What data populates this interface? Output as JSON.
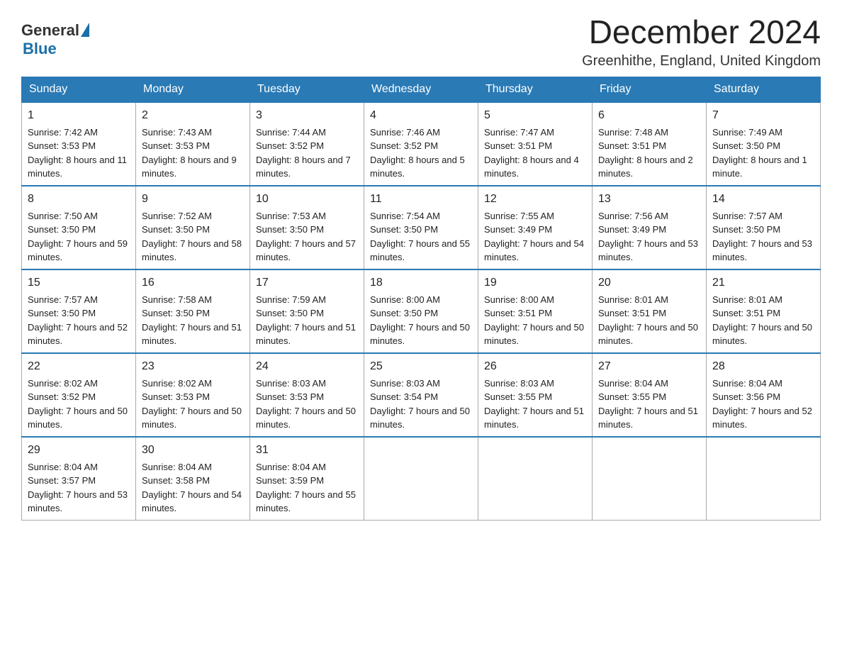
{
  "header": {
    "logo_general": "General",
    "logo_blue": "Blue",
    "title": "December 2024",
    "subtitle": "Greenhithe, England, United Kingdom"
  },
  "days_of_week": [
    "Sunday",
    "Monday",
    "Tuesday",
    "Wednesday",
    "Thursday",
    "Friday",
    "Saturday"
  ],
  "weeks": [
    [
      {
        "day": "1",
        "sunrise": "Sunrise: 7:42 AM",
        "sunset": "Sunset: 3:53 PM",
        "daylight": "Daylight: 8 hours and 11 minutes."
      },
      {
        "day": "2",
        "sunrise": "Sunrise: 7:43 AM",
        "sunset": "Sunset: 3:53 PM",
        "daylight": "Daylight: 8 hours and 9 minutes."
      },
      {
        "day": "3",
        "sunrise": "Sunrise: 7:44 AM",
        "sunset": "Sunset: 3:52 PM",
        "daylight": "Daylight: 8 hours and 7 minutes."
      },
      {
        "day": "4",
        "sunrise": "Sunrise: 7:46 AM",
        "sunset": "Sunset: 3:52 PM",
        "daylight": "Daylight: 8 hours and 5 minutes."
      },
      {
        "day": "5",
        "sunrise": "Sunrise: 7:47 AM",
        "sunset": "Sunset: 3:51 PM",
        "daylight": "Daylight: 8 hours and 4 minutes."
      },
      {
        "day": "6",
        "sunrise": "Sunrise: 7:48 AM",
        "sunset": "Sunset: 3:51 PM",
        "daylight": "Daylight: 8 hours and 2 minutes."
      },
      {
        "day": "7",
        "sunrise": "Sunrise: 7:49 AM",
        "sunset": "Sunset: 3:50 PM",
        "daylight": "Daylight: 8 hours and 1 minute."
      }
    ],
    [
      {
        "day": "8",
        "sunrise": "Sunrise: 7:50 AM",
        "sunset": "Sunset: 3:50 PM",
        "daylight": "Daylight: 7 hours and 59 minutes."
      },
      {
        "day": "9",
        "sunrise": "Sunrise: 7:52 AM",
        "sunset": "Sunset: 3:50 PM",
        "daylight": "Daylight: 7 hours and 58 minutes."
      },
      {
        "day": "10",
        "sunrise": "Sunrise: 7:53 AM",
        "sunset": "Sunset: 3:50 PM",
        "daylight": "Daylight: 7 hours and 57 minutes."
      },
      {
        "day": "11",
        "sunrise": "Sunrise: 7:54 AM",
        "sunset": "Sunset: 3:50 PM",
        "daylight": "Daylight: 7 hours and 55 minutes."
      },
      {
        "day": "12",
        "sunrise": "Sunrise: 7:55 AM",
        "sunset": "Sunset: 3:49 PM",
        "daylight": "Daylight: 7 hours and 54 minutes."
      },
      {
        "day": "13",
        "sunrise": "Sunrise: 7:56 AM",
        "sunset": "Sunset: 3:49 PM",
        "daylight": "Daylight: 7 hours and 53 minutes."
      },
      {
        "day": "14",
        "sunrise": "Sunrise: 7:57 AM",
        "sunset": "Sunset: 3:50 PM",
        "daylight": "Daylight: 7 hours and 53 minutes."
      }
    ],
    [
      {
        "day": "15",
        "sunrise": "Sunrise: 7:57 AM",
        "sunset": "Sunset: 3:50 PM",
        "daylight": "Daylight: 7 hours and 52 minutes."
      },
      {
        "day": "16",
        "sunrise": "Sunrise: 7:58 AM",
        "sunset": "Sunset: 3:50 PM",
        "daylight": "Daylight: 7 hours and 51 minutes."
      },
      {
        "day": "17",
        "sunrise": "Sunrise: 7:59 AM",
        "sunset": "Sunset: 3:50 PM",
        "daylight": "Daylight: 7 hours and 51 minutes."
      },
      {
        "day": "18",
        "sunrise": "Sunrise: 8:00 AM",
        "sunset": "Sunset: 3:50 PM",
        "daylight": "Daylight: 7 hours and 50 minutes."
      },
      {
        "day": "19",
        "sunrise": "Sunrise: 8:00 AM",
        "sunset": "Sunset: 3:51 PM",
        "daylight": "Daylight: 7 hours and 50 minutes."
      },
      {
        "day": "20",
        "sunrise": "Sunrise: 8:01 AM",
        "sunset": "Sunset: 3:51 PM",
        "daylight": "Daylight: 7 hours and 50 minutes."
      },
      {
        "day": "21",
        "sunrise": "Sunrise: 8:01 AM",
        "sunset": "Sunset: 3:51 PM",
        "daylight": "Daylight: 7 hours and 50 minutes."
      }
    ],
    [
      {
        "day": "22",
        "sunrise": "Sunrise: 8:02 AM",
        "sunset": "Sunset: 3:52 PM",
        "daylight": "Daylight: 7 hours and 50 minutes."
      },
      {
        "day": "23",
        "sunrise": "Sunrise: 8:02 AM",
        "sunset": "Sunset: 3:53 PM",
        "daylight": "Daylight: 7 hours and 50 minutes."
      },
      {
        "day": "24",
        "sunrise": "Sunrise: 8:03 AM",
        "sunset": "Sunset: 3:53 PM",
        "daylight": "Daylight: 7 hours and 50 minutes."
      },
      {
        "day": "25",
        "sunrise": "Sunrise: 8:03 AM",
        "sunset": "Sunset: 3:54 PM",
        "daylight": "Daylight: 7 hours and 50 minutes."
      },
      {
        "day": "26",
        "sunrise": "Sunrise: 8:03 AM",
        "sunset": "Sunset: 3:55 PM",
        "daylight": "Daylight: 7 hours and 51 minutes."
      },
      {
        "day": "27",
        "sunrise": "Sunrise: 8:04 AM",
        "sunset": "Sunset: 3:55 PM",
        "daylight": "Daylight: 7 hours and 51 minutes."
      },
      {
        "day": "28",
        "sunrise": "Sunrise: 8:04 AM",
        "sunset": "Sunset: 3:56 PM",
        "daylight": "Daylight: 7 hours and 52 minutes."
      }
    ],
    [
      {
        "day": "29",
        "sunrise": "Sunrise: 8:04 AM",
        "sunset": "Sunset: 3:57 PM",
        "daylight": "Daylight: 7 hours and 53 minutes."
      },
      {
        "day": "30",
        "sunrise": "Sunrise: 8:04 AM",
        "sunset": "Sunset: 3:58 PM",
        "daylight": "Daylight: 7 hours and 54 minutes."
      },
      {
        "day": "31",
        "sunrise": "Sunrise: 8:04 AM",
        "sunset": "Sunset: 3:59 PM",
        "daylight": "Daylight: 7 hours and 55 minutes."
      },
      null,
      null,
      null,
      null
    ]
  ]
}
